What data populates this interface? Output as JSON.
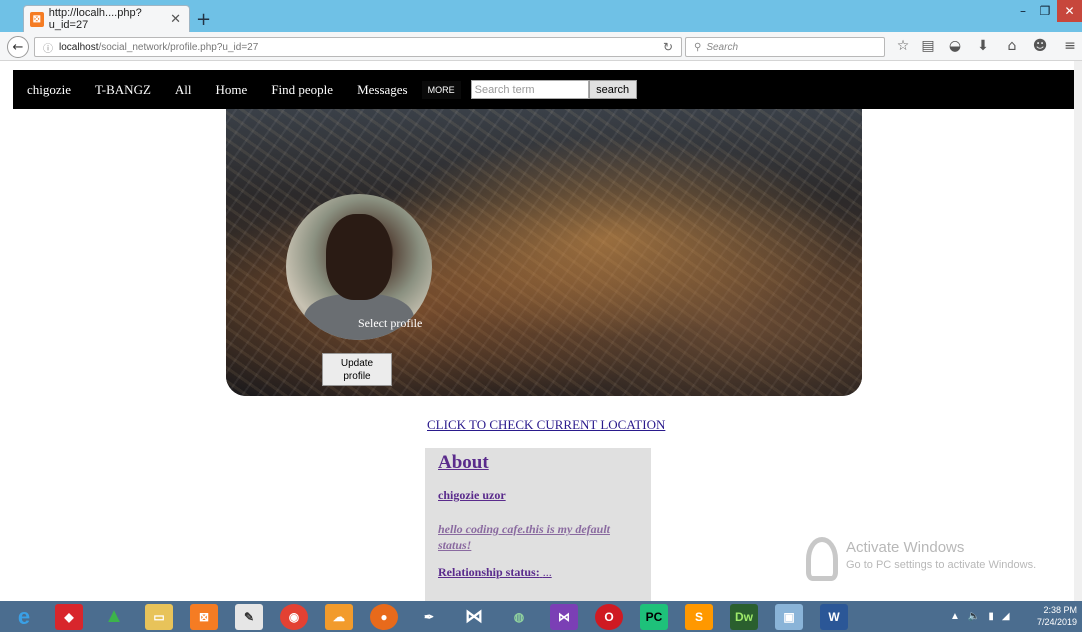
{
  "browser": {
    "tab_title": "http://localh....php?u_id=27",
    "url_host": "localhost",
    "url_path": "/social_network/profile.php?u_id=27",
    "search_placeholder": "Search"
  },
  "site_nav": {
    "items": [
      "chigozie",
      "T-BANGZ",
      "All",
      "Home",
      "Find people",
      "Messages"
    ],
    "more_label": "MORE",
    "search_placeholder": "Search term",
    "search_button": "search"
  },
  "cover": {
    "select_label": "Select profile",
    "update_label_line1": "Update",
    "update_label_line2": "profile"
  },
  "location_link": "CLICK TO CHECK CURRENT LOCATION",
  "about": {
    "heading": "About",
    "name": "chigozie uzor",
    "status": "hello coding cafe.this is my default status!",
    "relationship_label": "Relationship status:",
    "relationship_value": "..."
  },
  "watermark": {
    "title": "Activate Windows",
    "subtitle": "Go to PC settings to activate Windows."
  },
  "clock": {
    "time": "2:38 PM",
    "date": "7/24/2019"
  },
  "taskbar_apps": [
    "ie-icon",
    "shield-icon",
    "android-studio-icon",
    "file-explorer-icon",
    "xampp-icon",
    "notepad-icon",
    "chrome-icon",
    "uc-browser-icon",
    "firefox-icon",
    "pen-icon",
    "visual-studio-icon",
    "android-icon",
    "visual-studio-2-icon",
    "opera-icon",
    "pycharm-icon",
    "sublime-icon",
    "dreamweaver-icon",
    "photos-icon",
    "word-icon"
  ],
  "colors": {
    "tabbar": "#6fc1e6",
    "site_nav_bg": "#000000",
    "link": "#2a1a8c",
    "about_bg": "#e0e0e0",
    "taskbar": "#4b6d8f"
  }
}
